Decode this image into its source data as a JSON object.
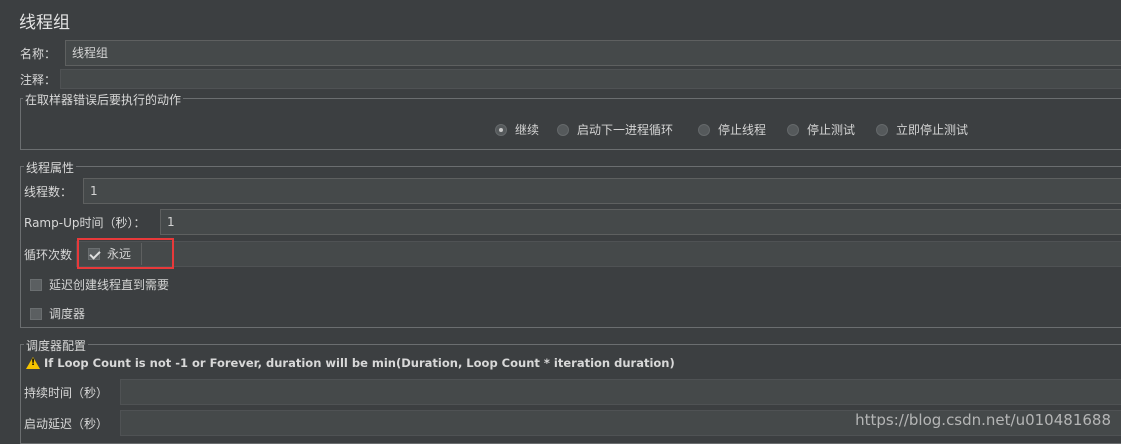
{
  "page_title": "线程组",
  "name": {
    "label": "名称：",
    "value": "线程组"
  },
  "comment": {
    "label": "注释：",
    "value": ""
  },
  "error_action": {
    "legend": "在取样器错误后要执行的动作",
    "options": [
      "继续",
      "启动下一进程循环",
      "停止线程",
      "停止测试",
      "立即停止测试"
    ],
    "selected": "继续"
  },
  "thread_props": {
    "legend": "线程属性",
    "threads_label": "线程数：",
    "threads_value": "1",
    "rampup_label": "Ramp-Up时间（秒）：",
    "rampup_value": "1",
    "loop_label": "循环次数",
    "forever_label": "永远",
    "forever_checked": true,
    "delay_label": "延迟创建线程直到需要",
    "delay_checked": false,
    "scheduler_label": "调度器",
    "scheduler_checked": false
  },
  "scheduler_config": {
    "legend": "调度器配置",
    "warning": "If Loop Count is not -1 or Forever, duration will be min(Duration, Loop Count * iteration duration)",
    "duration_label": "持续时间（秒）",
    "duration_value": "",
    "startup_delay_label": "启动延迟（秒）",
    "startup_delay_value": ""
  },
  "watermark": "https://blog.csdn.net/u010481688",
  "colors": {
    "background": "#3c3f41",
    "field": "#45494a",
    "highlight": "#e8393a",
    "warning": "#f5c400"
  }
}
